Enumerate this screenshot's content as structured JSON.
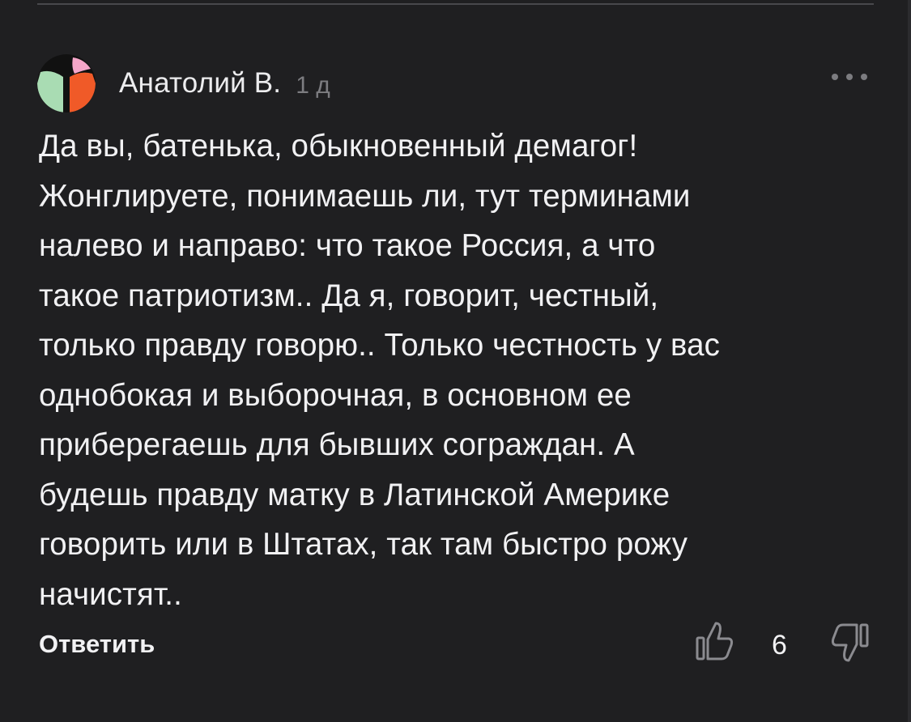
{
  "comment": {
    "author": "Анатолий В.",
    "time": "1 д",
    "text_lines": [
      "Да вы, батенька, обыкновенный демагог!",
      "Жонглируете, понимаешь ли, тут терминами",
      "налево и направо: что такое Россия, а что",
      "такое патриотизм.. Да я, говорит, честный,",
      "только правду говорю.. Только честность у вас",
      "однобокая и выборочная, в основном ее",
      "приберегаешь для бывших сограждан. А",
      "будешь правду матку в Латинской Америке",
      "говорить или в Штатах, так там быстро рожу",
      "начистят.."
    ],
    "reply_label": "Ответить",
    "like_count": "6"
  },
  "icons": {
    "avatar": "avatar-geometric",
    "more": "more-dots-icon",
    "like": "thumbs-up-icon",
    "dislike": "thumbs-down-icon"
  },
  "colors": {
    "background": "#1f1f21",
    "text": "#f1f1f3",
    "muted": "#7c7c80",
    "avatar_green": "#a9dcb3",
    "avatar_orange": "#f05a28",
    "avatar_pink": "#f5a6c9",
    "avatar_black": "#111111"
  }
}
